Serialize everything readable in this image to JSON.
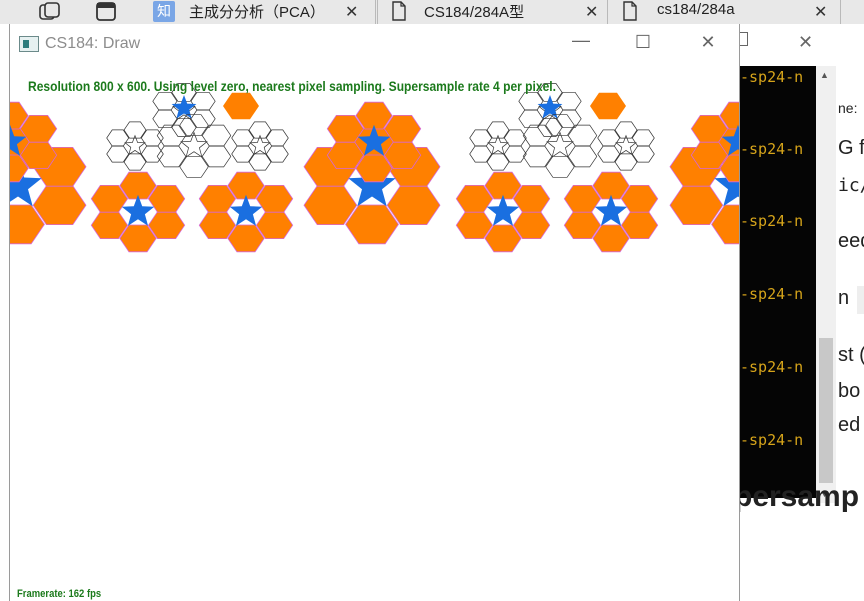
{
  "browser": {
    "tabs": [
      {
        "title": "主成分分析（PCA）",
        "icon": "zhihu-icon",
        "close": "✕"
      },
      {
        "title": "CS184/284A型",
        "icon": "document-icon",
        "close": "✕"
      },
      {
        "title": "cs184/284a",
        "icon": "document-icon",
        "close": "✕"
      }
    ]
  },
  "background_page": {
    "terminal_lines": [
      "-sp24-n",
      "-sp24-n",
      "-sp24-n",
      "-sp24-n",
      "-sp24-n",
      "-sp24-n"
    ],
    "snippets": [
      "ne:",
      "G f",
      "ic/",
      "eed",
      "n",
      "st (",
      "bo",
      "ed",
      "persamp"
    ]
  },
  "app_window": {
    "title": "CS184: Draw",
    "minimize": "—",
    "maximize": "☐",
    "close": "✕"
  },
  "canvas": {
    "status": "Resolution 800 x 600. Using level zero, nearest pixel sampling. Supersample rate 4 per pixel.",
    "framerate": "Framerate: 162 fps",
    "colors": {
      "hexagon": "#ff8000",
      "star": "#1a6fe0",
      "text": "#1c7a1c",
      "outline": "#333333"
    }
  }
}
